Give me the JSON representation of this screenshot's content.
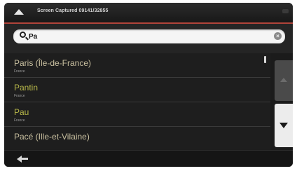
{
  "titlebar": {
    "title": "Screen Captured 09141/32855"
  },
  "search": {
    "value": "Pa",
    "clear_symbol": "×"
  },
  "results": [
    {
      "name": "Paris (Île-de-France)",
      "country": "France",
      "highlight": false
    },
    {
      "name": "Pantin",
      "country": "France",
      "highlight": true
    },
    {
      "name": "Pau",
      "country": "France",
      "highlight": true
    },
    {
      "name": "Pacé (Ille-et-Vilaine)",
      "country": "",
      "highlight": false
    }
  ],
  "icons": {
    "title_up": "up-arrow-icon",
    "search": "search-icon",
    "clear": "clear-icon",
    "scroll_up": "up-arrow-icon",
    "scroll_down": "down-arrow-icon",
    "back": "back-arrow-icon"
  },
  "colors": {
    "accent": "#b0443a",
    "result_text": "#c9c0a0",
    "result_highlight": "#b8b84a"
  }
}
